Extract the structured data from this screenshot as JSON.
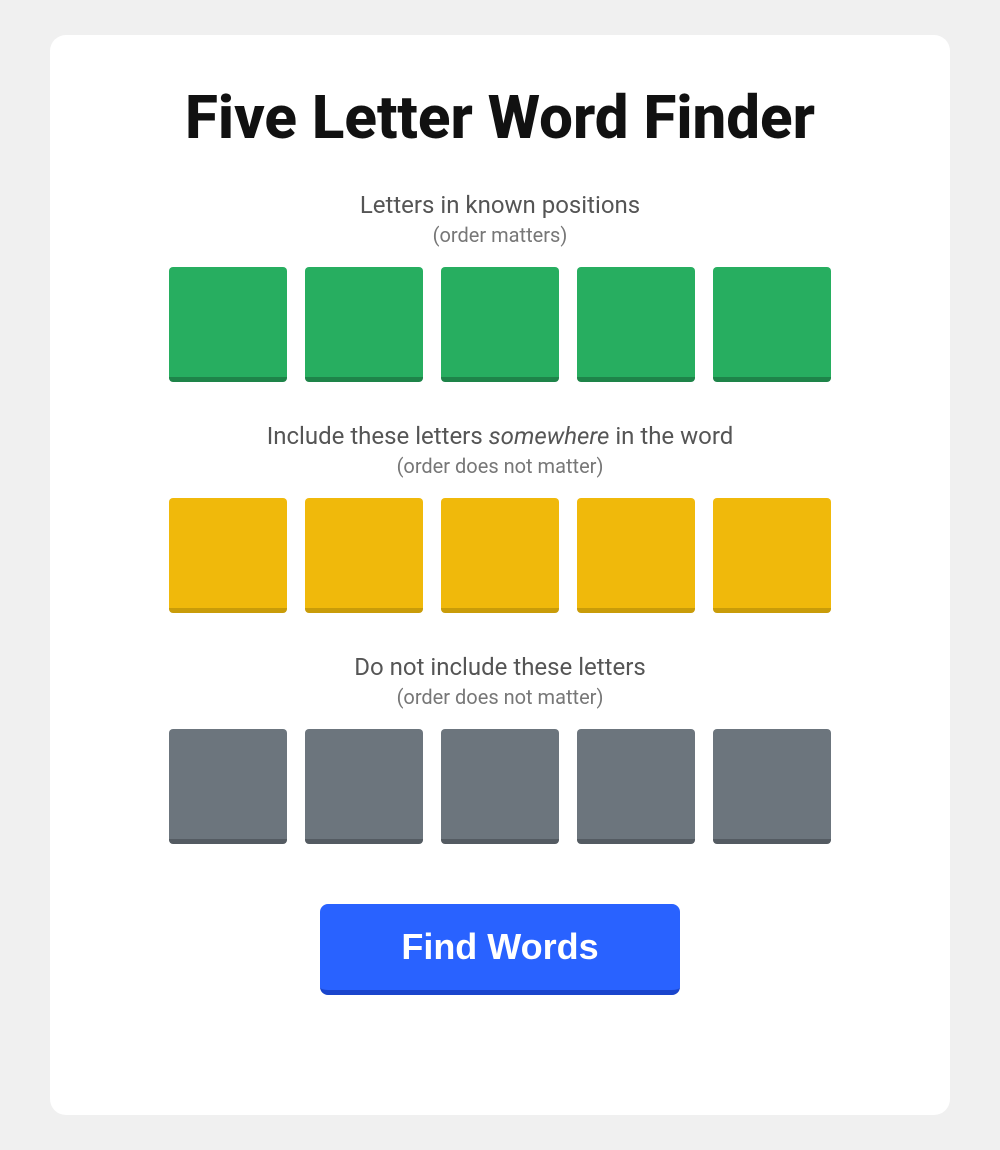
{
  "page": {
    "title": "Five Letter Word Finder",
    "background_color": "#f0f0f0"
  },
  "sections": {
    "known_positions": {
      "label": "Letters in known positions",
      "sublabel": "(order matters)",
      "tile_color": "green",
      "tiles": [
        {
          "id": 1,
          "value": ""
        },
        {
          "id": 2,
          "value": ""
        },
        {
          "id": 3,
          "value": ""
        },
        {
          "id": 4,
          "value": ""
        },
        {
          "id": 5,
          "value": ""
        }
      ]
    },
    "include_letters": {
      "label_start": "Include these letters ",
      "label_italic": "somewhere",
      "label_end": " in the word",
      "sublabel": "(order does not matter)",
      "tile_color": "yellow",
      "tiles": [
        {
          "id": 1,
          "value": ""
        },
        {
          "id": 2,
          "value": ""
        },
        {
          "id": 3,
          "value": ""
        },
        {
          "id": 4,
          "value": ""
        },
        {
          "id": 5,
          "value": ""
        }
      ]
    },
    "exclude_letters": {
      "label": "Do not include these letters",
      "sublabel": "(order does not matter)",
      "tile_color": "gray",
      "tiles": [
        {
          "id": 1,
          "value": ""
        },
        {
          "id": 2,
          "value": ""
        },
        {
          "id": 3,
          "value": ""
        },
        {
          "id": 4,
          "value": ""
        },
        {
          "id": 5,
          "value": ""
        }
      ]
    }
  },
  "button": {
    "label": "Find Words"
  }
}
